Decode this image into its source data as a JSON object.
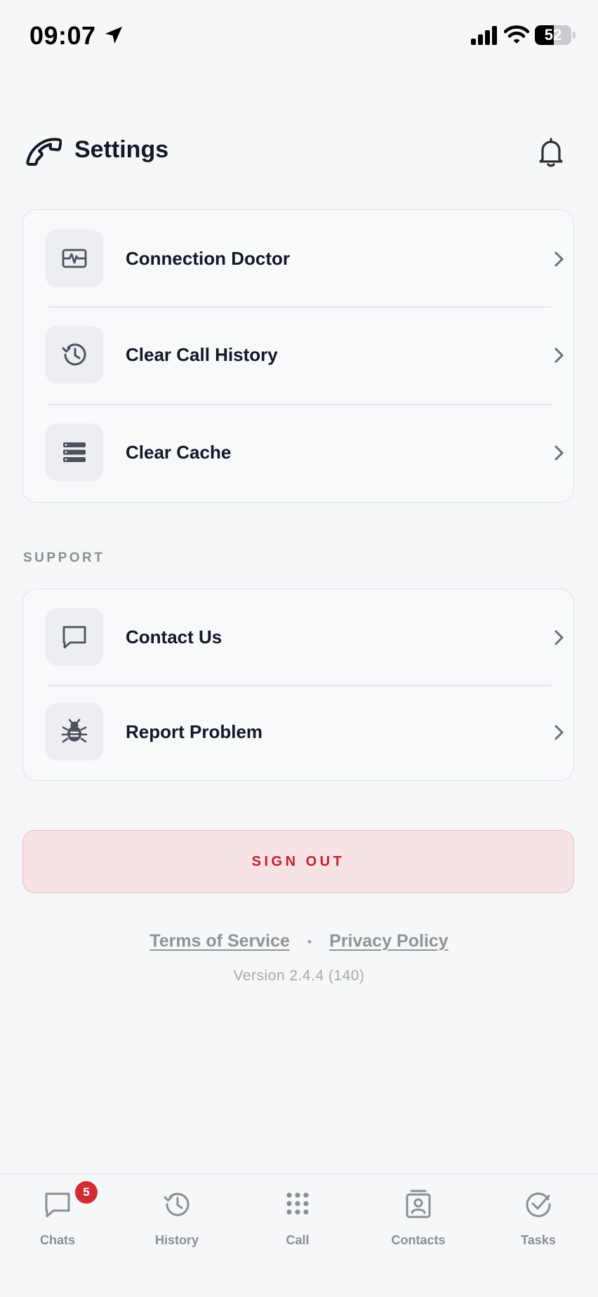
{
  "status_bar": {
    "time": "09:07",
    "battery_level": "52",
    "battery_fraction": 0.52
  },
  "header": {
    "title": "Settings",
    "logo_icon": "phone-handset-icon",
    "notification_icon": "bell-icon"
  },
  "tools": {
    "items": [
      {
        "label": "Connection Doctor",
        "icon": "pulse-monitor-icon"
      },
      {
        "label": "Clear Call History",
        "icon": "history-clock-icon"
      },
      {
        "label": "Clear Cache",
        "icon": "storage-stack-icon"
      }
    ]
  },
  "support": {
    "heading": "SUPPORT",
    "items": [
      {
        "label": "Contact Us",
        "icon": "chat-bubble-icon"
      },
      {
        "label": "Report Problem",
        "icon": "bug-icon"
      }
    ]
  },
  "sign_out": {
    "label": "SIGN OUT",
    "color": "#c8202e"
  },
  "legal": {
    "terms": "Terms of Service",
    "separator": "•",
    "privacy": "Privacy Policy",
    "version": "Version 2.4.4 (140)"
  },
  "tab_bar": {
    "tabs": [
      {
        "label": "Chats",
        "icon": "chat-bubble-icon",
        "badge": "5"
      },
      {
        "label": "History",
        "icon": "history-clock-icon"
      },
      {
        "label": "Call",
        "icon": "dialpad-icon"
      },
      {
        "label": "Contacts",
        "icon": "contact-card-icon"
      },
      {
        "label": "Tasks",
        "icon": "check-circle-icon"
      }
    ]
  },
  "colors": {
    "background": "#f6f7f9",
    "text_primary": "#141824",
    "text_muted": "#8a8e96",
    "danger": "#c8202e",
    "badge": "#d42a35"
  }
}
